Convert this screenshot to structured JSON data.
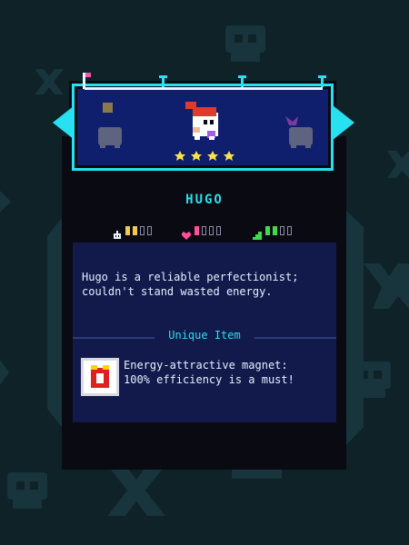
{
  "character": {
    "name": "HUGO",
    "rating_stars": 4,
    "description": "Hugo is a reliable perfectionist;\ncouldn't stand wasted energy.",
    "selector": {
      "prev_icon": "left-arrow-icon",
      "next_icon": "right-arrow-icon"
    }
  },
  "stats": [
    {
      "icon": "robot-icon",
      "color": "#f2c94c",
      "value": 2,
      "max": 4
    },
    {
      "icon": "heart-icon",
      "color": "#ff4f9a",
      "value": 1,
      "max": 4
    },
    {
      "icon": "stairs-icon",
      "color": "#3ddc4a",
      "value": 2,
      "max": 4
    }
  ],
  "unique_item": {
    "section_title": "Unique Item",
    "icon": "magnet-icon",
    "description": "Energy-attractive magnet:\n100% efficiency is a must!"
  },
  "colors": {
    "accent": "#27e0f0",
    "background": "#0e2228",
    "panel": "#0a0a12",
    "header_bg": "#0f1f6e",
    "desc_bg": "#111a4a",
    "star": "#ffe14a"
  }
}
